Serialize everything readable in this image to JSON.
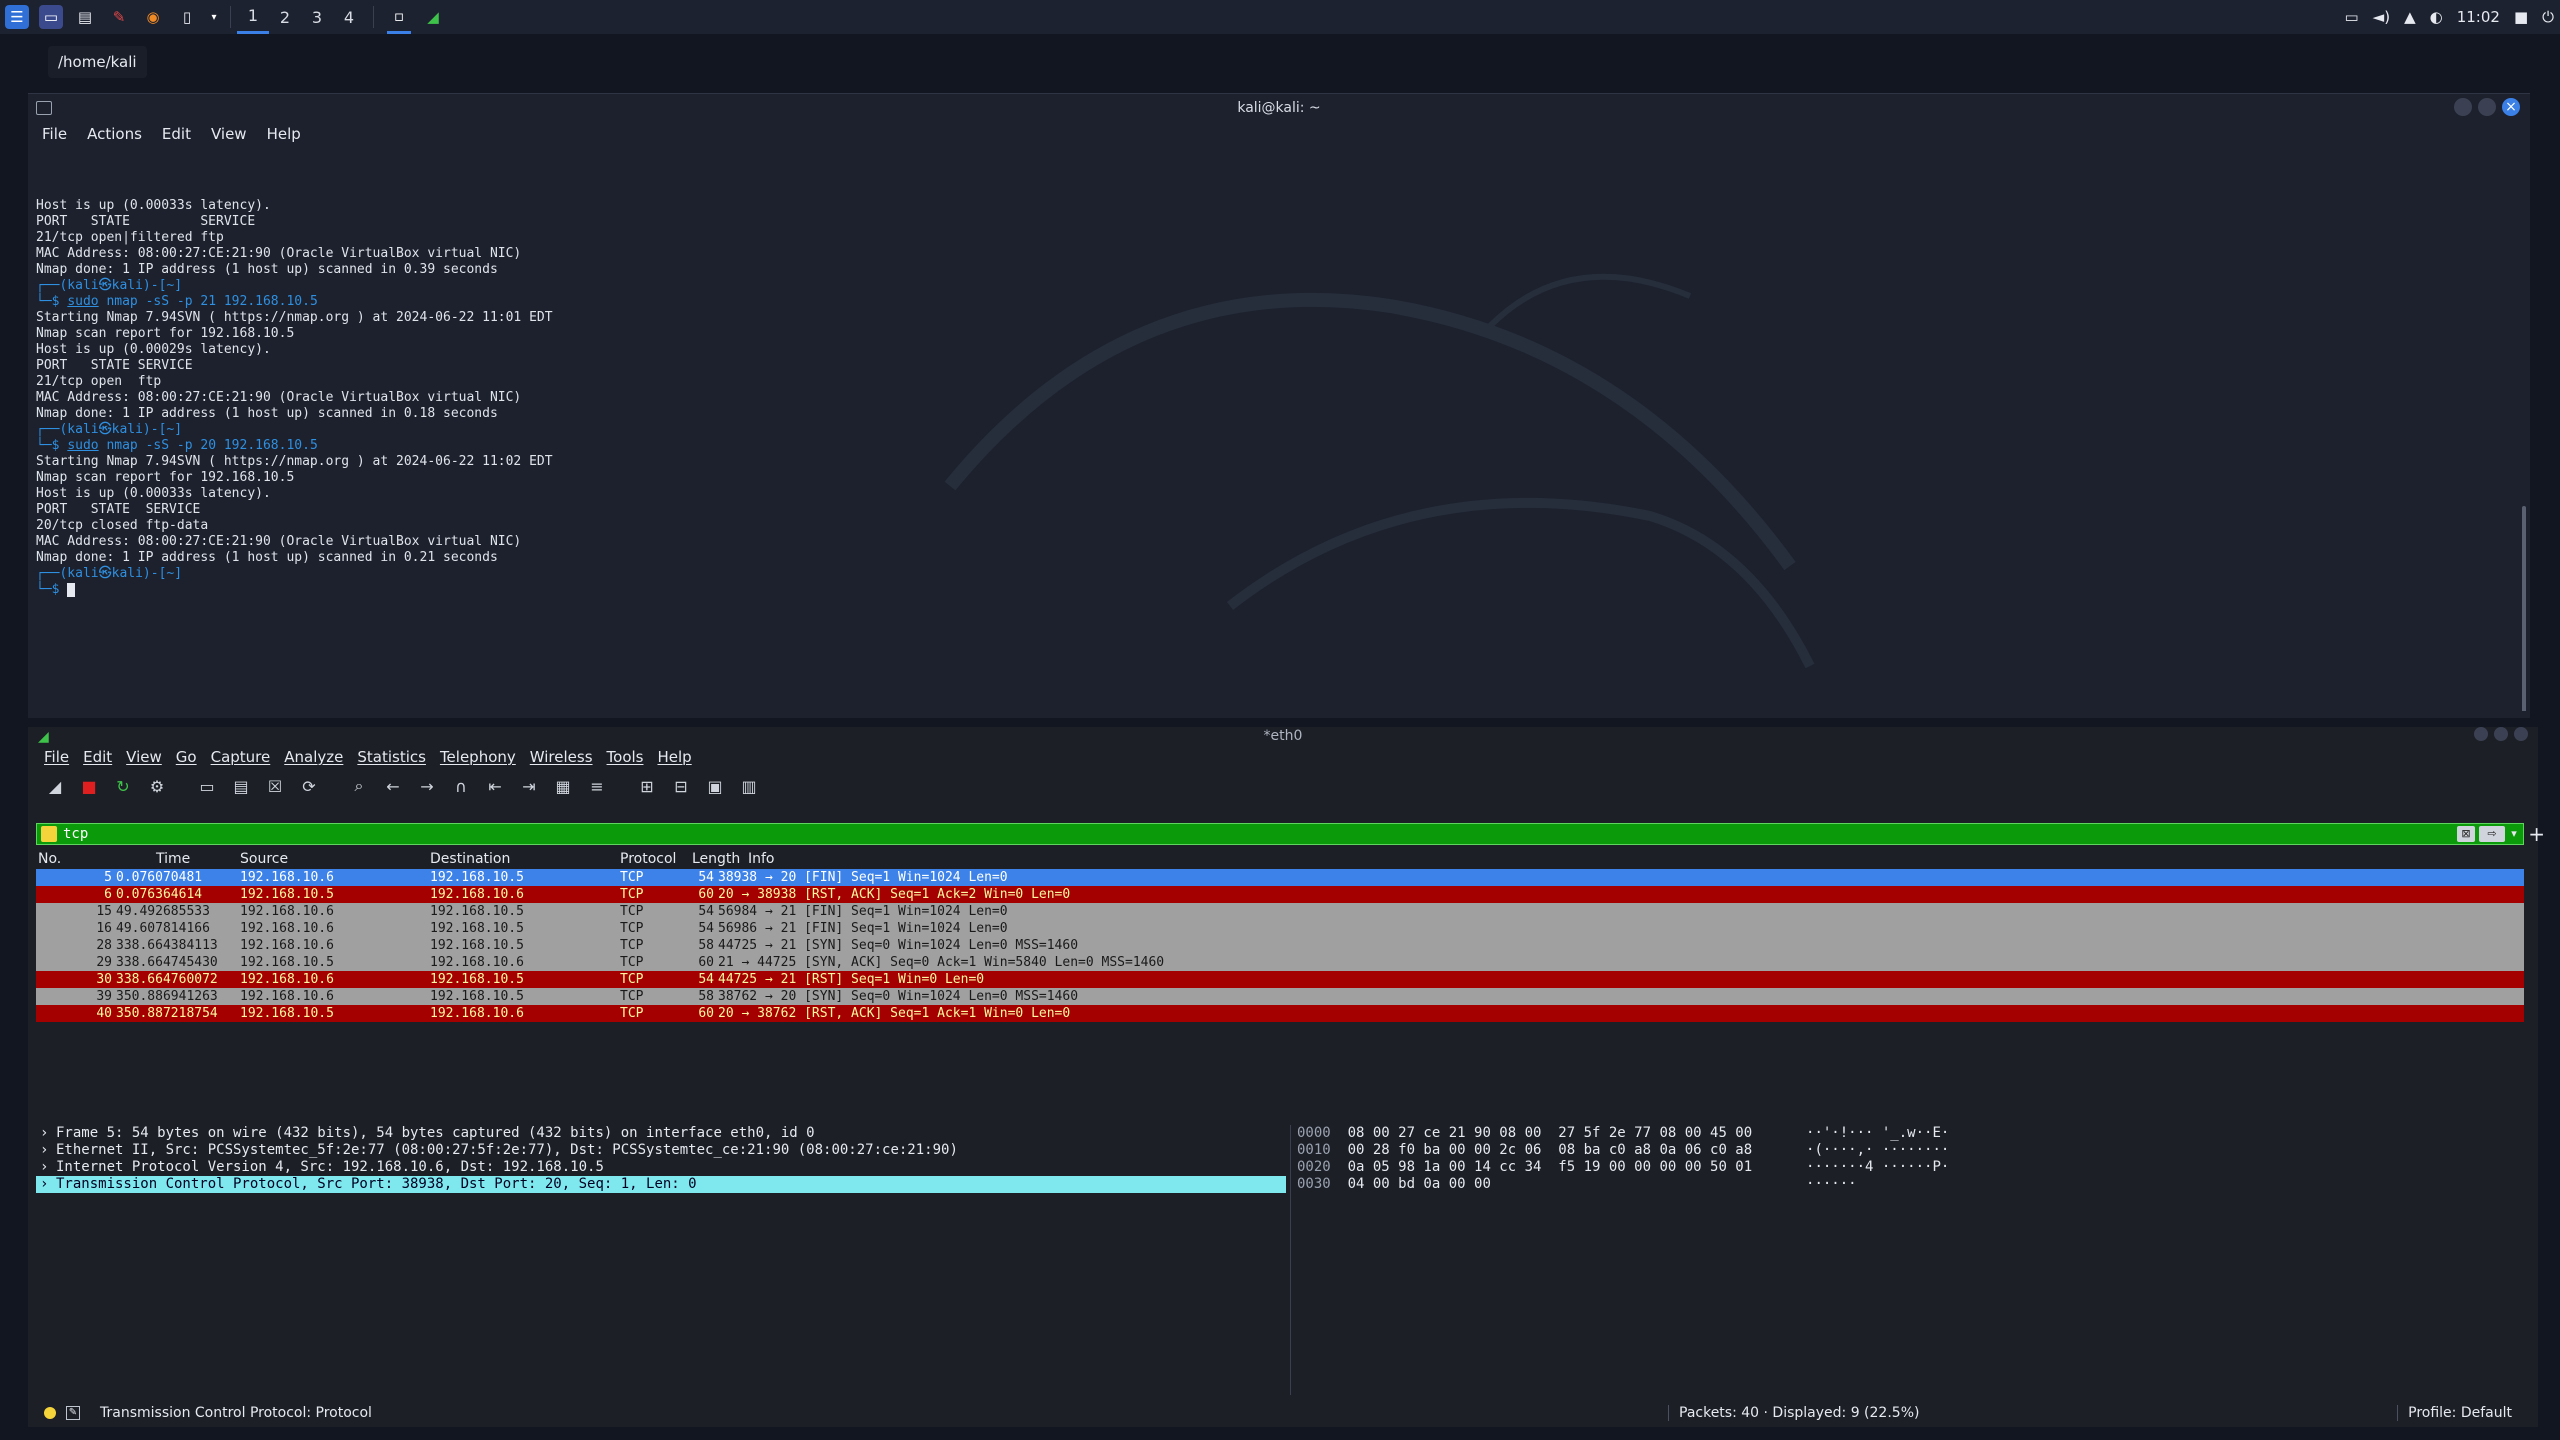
{
  "taskbar": {
    "workspaces": [
      "1",
      "2",
      "3",
      "4"
    ],
    "clock": "11:02"
  },
  "tooltip": "/home/kali",
  "terminal": {
    "title": "kali@kali: ~",
    "menu": [
      "File",
      "Actions",
      "Edit",
      "View",
      "Help"
    ],
    "lines": [
      {
        "t": "out",
        "text": "Host is up (0.00033s latency)."
      },
      {
        "t": "out",
        "text": ""
      },
      {
        "t": "out",
        "text": "PORT   STATE         SERVICE"
      },
      {
        "t": "out",
        "text": "21/tcp open|filtered ftp"
      },
      {
        "t": "out",
        "text": "MAC Address: 08:00:27:CE:21:90 (Oracle VirtualBox virtual NIC)"
      },
      {
        "t": "out",
        "text": ""
      },
      {
        "t": "out",
        "text": "Nmap done: 1 IP address (1 host up) scanned in 0.39 seconds"
      },
      {
        "t": "out",
        "text": ""
      },
      {
        "t": "prompt",
        "text": "┌──(kali㉿kali)-[~]"
      },
      {
        "t": "cmd",
        "prefix": "└─$ ",
        "sudo": "sudo",
        "text": " nmap -sS -p 21 192.168.10.5"
      },
      {
        "t": "out",
        "text": "Starting Nmap 7.94SVN ( https://nmap.org ) at 2024-06-22 11:01 EDT"
      },
      {
        "t": "out",
        "text": "Nmap scan report for 192.168.10.5"
      },
      {
        "t": "out",
        "text": "Host is up (0.00029s latency)."
      },
      {
        "t": "out",
        "text": ""
      },
      {
        "t": "out",
        "text": "PORT   STATE SERVICE"
      },
      {
        "t": "out",
        "text": "21/tcp open  ftp"
      },
      {
        "t": "out",
        "text": "MAC Address: 08:00:27:CE:21:90 (Oracle VirtualBox virtual NIC)"
      },
      {
        "t": "out",
        "text": ""
      },
      {
        "t": "out",
        "text": "Nmap done: 1 IP address (1 host up) scanned in 0.18 seconds"
      },
      {
        "t": "out",
        "text": ""
      },
      {
        "t": "prompt",
        "text": "┌──(kali㉿kali)-[~]"
      },
      {
        "t": "cmd",
        "prefix": "└─$ ",
        "sudo": "sudo",
        "text": " nmap -sS -p 20 192.168.10.5"
      },
      {
        "t": "out",
        "text": "Starting Nmap 7.94SVN ( https://nmap.org ) at 2024-06-22 11:02 EDT"
      },
      {
        "t": "out",
        "text": "Nmap scan report for 192.168.10.5"
      },
      {
        "t": "out",
        "text": "Host is up (0.00033s latency)."
      },
      {
        "t": "out",
        "text": ""
      },
      {
        "t": "out",
        "text": "PORT   STATE  SERVICE"
      },
      {
        "t": "out",
        "text": "20/tcp closed ftp-data"
      },
      {
        "t": "out",
        "text": "MAC Address: 08:00:27:CE:21:90 (Oracle VirtualBox virtual NIC)"
      },
      {
        "t": "out",
        "text": ""
      },
      {
        "t": "out",
        "text": "Nmap done: 1 IP address (1 host up) scanned in 0.21 seconds"
      },
      {
        "t": "out",
        "text": ""
      },
      {
        "t": "prompt",
        "text": "┌──(kali㉿kali)-[~]"
      },
      {
        "t": "cursor",
        "prefix": "└─$ "
      }
    ]
  },
  "wireshark": {
    "title": "*eth0",
    "menu": [
      "File",
      "Edit",
      "View",
      "Go",
      "Capture",
      "Analyze",
      "Statistics",
      "Telephony",
      "Wireless",
      "Tools",
      "Help"
    ],
    "filter": "tcp",
    "columns": [
      "No.",
      "Time",
      "Source",
      "Destination",
      "Protocol",
      "Length",
      "Info"
    ],
    "packets": [
      {
        "no": "5",
        "time": "0.076070481",
        "src": "192.168.10.6",
        "dst": "192.168.10.5",
        "proto": "TCP",
        "len": "54",
        "info": "38938 → 20 [FIN] Seq=1 Win=1024 Len=0",
        "style": "sel"
      },
      {
        "no": "6",
        "time": "0.076364614",
        "src": "192.168.10.5",
        "dst": "192.168.10.6",
        "proto": "TCP",
        "len": "60",
        "info": "20 → 38938 [RST, ACK] Seq=1 Ack=2 Win=0 Len=0",
        "style": "red"
      },
      {
        "no": "15",
        "time": "49.492685533",
        "src": "192.168.10.6",
        "dst": "192.168.10.5",
        "proto": "TCP",
        "len": "54",
        "info": "56984 → 21 [FIN] Seq=1 Win=1024 Len=0",
        "style": "gray"
      },
      {
        "no": "16",
        "time": "49.607814166",
        "src": "192.168.10.6",
        "dst": "192.168.10.5",
        "proto": "TCP",
        "len": "54",
        "info": "56986 → 21 [FIN] Seq=1 Win=1024 Len=0",
        "style": "gray"
      },
      {
        "no": "28",
        "time": "338.664384113",
        "src": "192.168.10.6",
        "dst": "192.168.10.5",
        "proto": "TCP",
        "len": "58",
        "info": "44725 → 21 [SYN] Seq=0 Win=1024 Len=0 MSS=1460",
        "style": "gray"
      },
      {
        "no": "29",
        "time": "338.664745430",
        "src": "192.168.10.5",
        "dst": "192.168.10.6",
        "proto": "TCP",
        "len": "60",
        "info": "21 → 44725 [SYN, ACK] Seq=0 Ack=1 Win=5840 Len=0 MSS=1460",
        "style": "gray"
      },
      {
        "no": "30",
        "time": "338.664760072",
        "src": "192.168.10.6",
        "dst": "192.168.10.5",
        "proto": "TCP",
        "len": "54",
        "info": "44725 → 21 [RST] Seq=1 Win=0 Len=0",
        "style": "red"
      },
      {
        "no": "39",
        "time": "350.886941263",
        "src": "192.168.10.6",
        "dst": "192.168.10.5",
        "proto": "TCP",
        "len": "58",
        "info": "38762 → 20 [SYN] Seq=0 Win=1024 Len=0 MSS=1460",
        "style": "gray"
      },
      {
        "no": "40",
        "time": "350.887218754",
        "src": "192.168.10.5",
        "dst": "192.168.10.6",
        "proto": "TCP",
        "len": "60",
        "info": "20 → 38762 [RST, ACK] Seq=1 Ack=1 Win=0 Len=0",
        "style": "red"
      }
    ],
    "details": [
      {
        "text": "Frame 5: 54 bytes on wire (432 bits), 54 bytes captured (432 bits) on interface eth0, id 0",
        "selected": false
      },
      {
        "text": "Ethernet II, Src: PCSSystemtec_5f:2e:77 (08:00:27:5f:2e:77), Dst: PCSSystemtec_ce:21:90 (08:00:27:ce:21:90)",
        "selected": false
      },
      {
        "text": "Internet Protocol Version 4, Src: 192.168.10.6, Dst: 192.168.10.5",
        "selected": false
      },
      {
        "text": "Transmission Control Protocol, Src Port: 38938, Dst Port: 20, Seq: 1, Len: 0",
        "selected": true
      }
    ],
    "hex": [
      {
        "off": "0000",
        "hex": "08 00 27 ce 21 90 08 00  27 5f 2e 77 08 00 45 00",
        "ascii": "··'·!··· '_.w··E·"
      },
      {
        "off": "0010",
        "hex": "00 28 f0 ba 00 00 2c 06  08 ba c0 a8 0a 06 c0 a8",
        "ascii": "·(····,· ········"
      },
      {
        "off": "0020",
        "hex": "0a 05 98 1a 00 14 cc 34  f5 19 00 00 00 00 50 01",
        "ascii": "·······4 ······P·"
      },
      {
        "off": "0030",
        "hex": "04 00 bd 0a 00 00",
        "ascii": "······"
      }
    ],
    "status": {
      "main": "Transmission Control Protocol: Protocol",
      "packets": "Packets: 40 · Displayed: 9 (22.5%)",
      "profile": "Profile: Default"
    }
  }
}
